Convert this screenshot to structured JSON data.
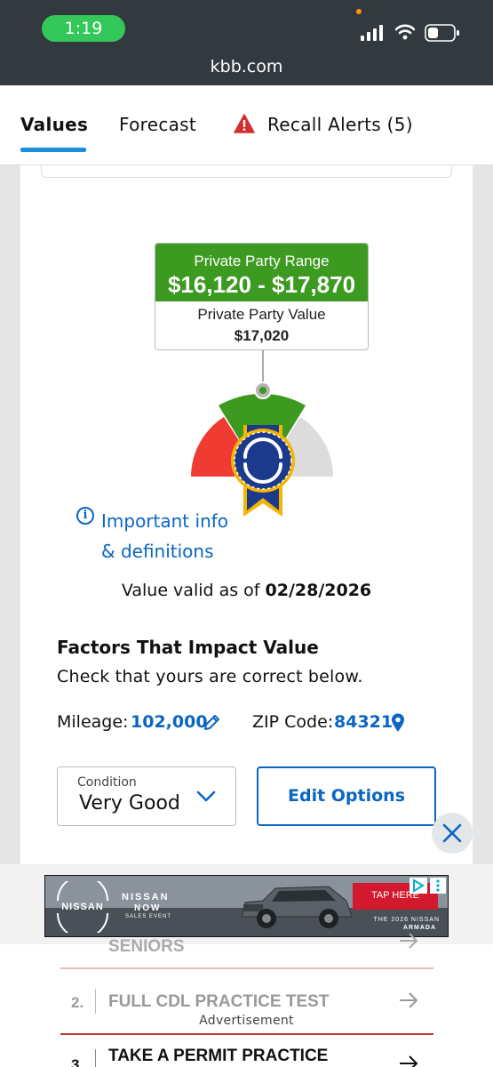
{
  "status_bar": {
    "time": "1:19",
    "url": "kbb.com"
  },
  "tabs": [
    {
      "label": "Values",
      "active": true
    },
    {
      "label": "Forecast"
    },
    {
      "label": "Recall Alerts (5)",
      "icon": "warning-triangle-icon",
      "icon_color": "#d32f2f"
    }
  ],
  "valuation": {
    "range_label": "Private Party Range",
    "range_value": "$16,120 - $17,870",
    "value_label": "Private Party Value",
    "value": "$17,020",
    "colors": {
      "range_green": "#3b9a1f",
      "gauge_red": "#ef3b32",
      "gauge_gray": "#dcdcdc",
      "badge_blue": "#1b3a8c",
      "badge_gold": "#f4b400"
    }
  },
  "info": {
    "line1": "Important info",
    "line2": "& definitions"
  },
  "valid": {
    "label": "Value valid as of",
    "date": "02/28/2026"
  },
  "factors": {
    "title": "Factors That Impact Value",
    "subtitle": "Check that yours are correct below.",
    "mileage_label": "Mileage:",
    "mileage_value": "102,000",
    "zip_label": "ZIP Code:",
    "zip_value": "84321"
  },
  "condition": {
    "label": "Condition",
    "value": "Very Good"
  },
  "edit_options": "Edit Options",
  "ad": {
    "brand": "NISSAN",
    "brand_now": "NISSAN",
    "now_word": "NOW",
    "sales_event": "SALES EVENT",
    "cta": "TAP HERE",
    "tagline_line1": "THE 2026 NISSAN",
    "tagline_line2": "ARMADA",
    "cta_color": "#d2192d"
  },
  "bottom_list": {
    "item0_text": "SENIORS",
    "item1_num": "2.",
    "item1_text": "FULL CDL PRACTICE TEST",
    "advertisement_label": "Advertisement",
    "item2_num": "3.",
    "item2_text": "TAKE A PERMIT PRACTICE"
  }
}
